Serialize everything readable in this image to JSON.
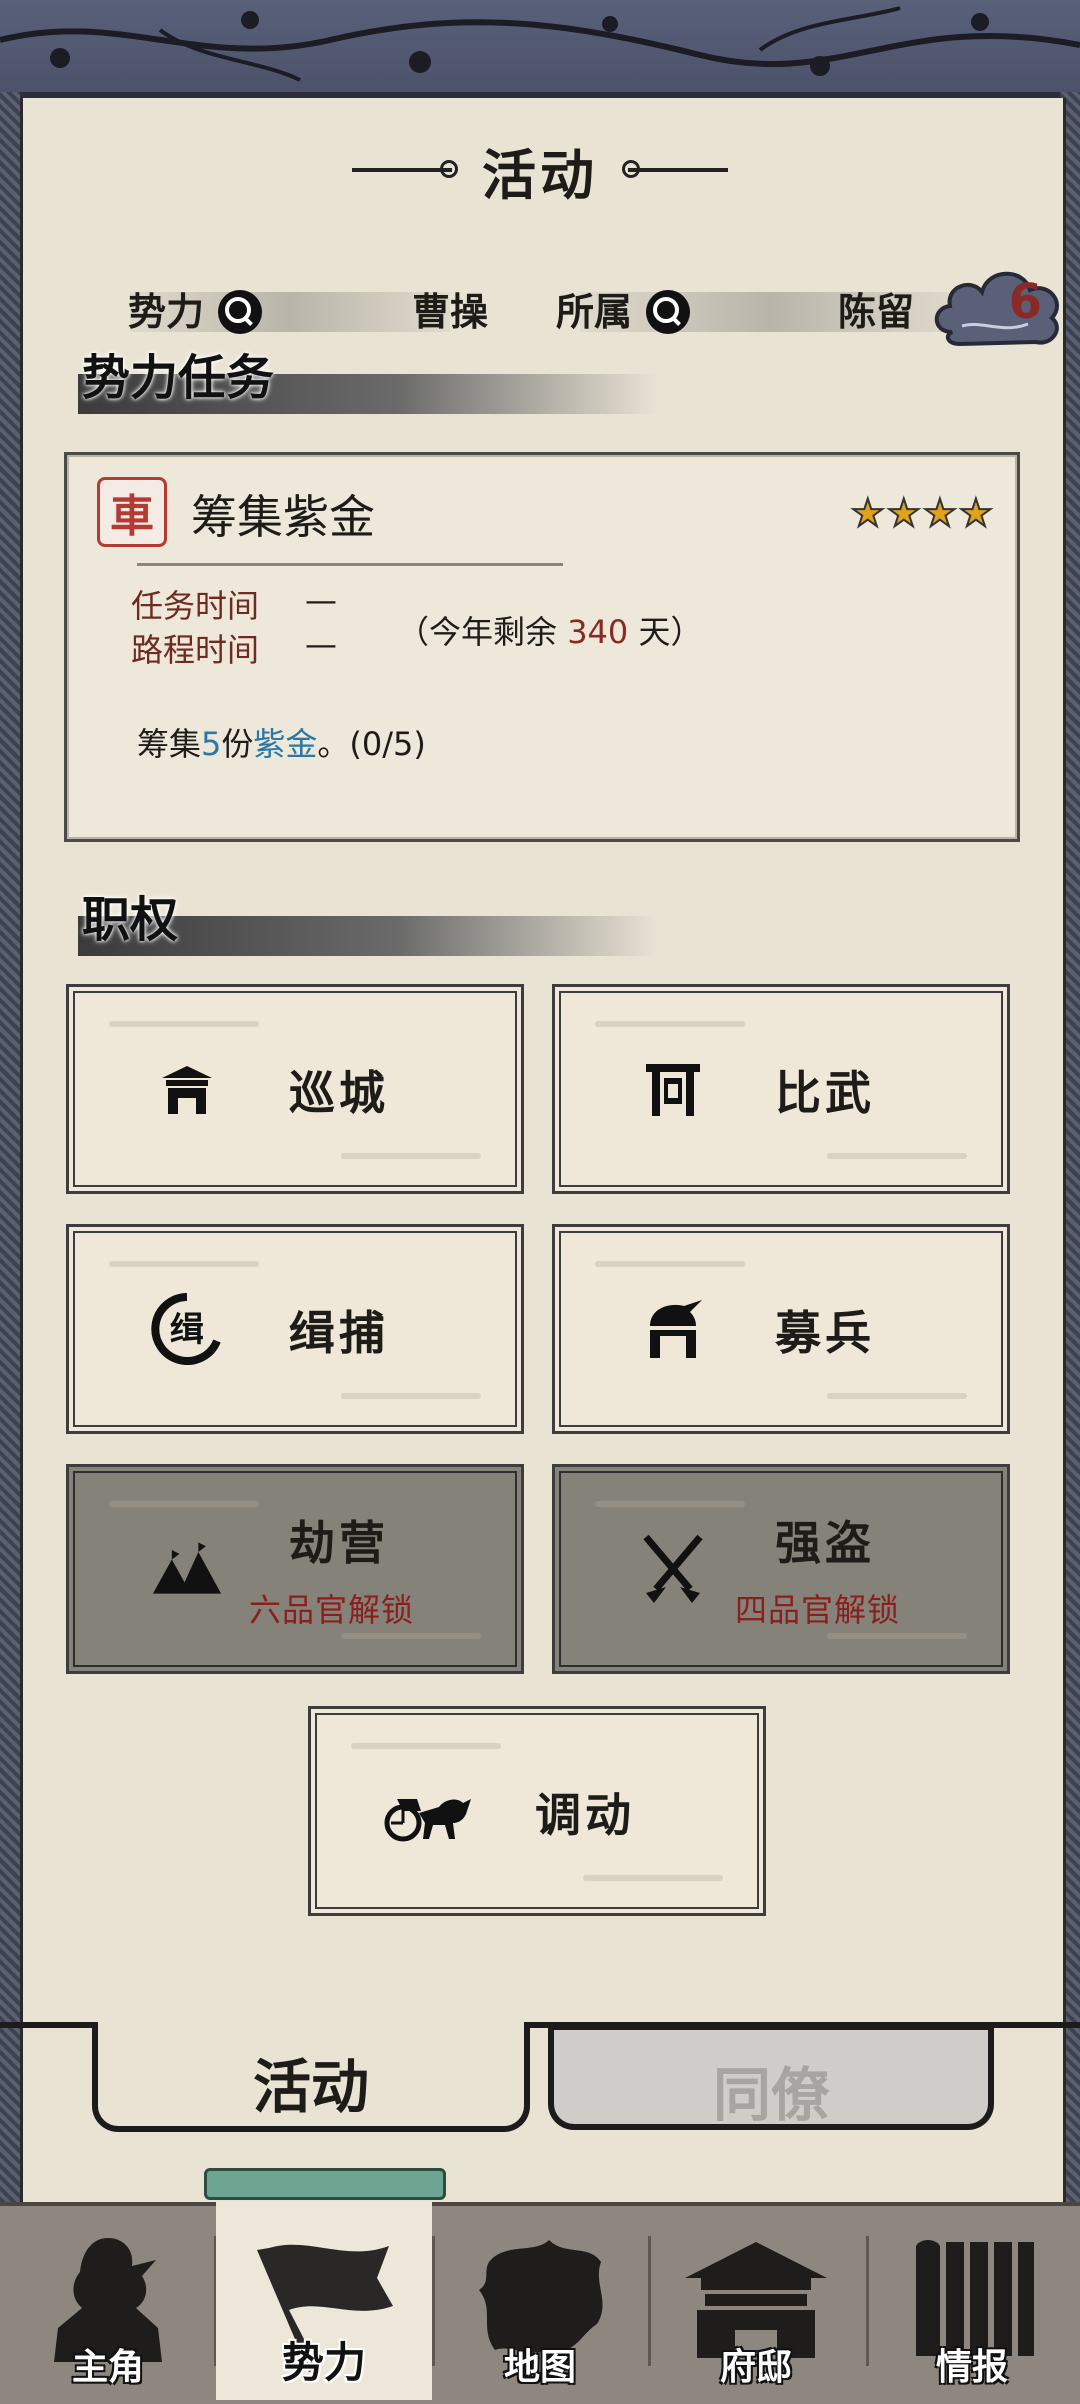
{
  "header": {
    "title": "活动"
  },
  "faction_info": {
    "faction_label": "势力",
    "faction_value": "曹操",
    "belong_label": "所属",
    "belong_value": "陈留",
    "badge_count": "6"
  },
  "faction_tasks": {
    "section_title": "势力任务",
    "task": {
      "seal_char": "車",
      "name": "筹集紫金",
      "stars": 4,
      "task_time_label": "任务时间",
      "task_time_value": "—",
      "route_time_label": "路程时间",
      "route_time_value": "—",
      "remaining_prefix": "（今年剩余",
      "remaining_days": "340",
      "remaining_suffix": "天）",
      "desc_prefix": "筹集",
      "desc_count": "5",
      "desc_mid": "份",
      "desc_item": "紫金",
      "desc_suffix": "。(0/5)"
    }
  },
  "powers": {
    "section_title": "职权",
    "buttons": [
      {
        "label": "巡城",
        "icon": "city-gate-icon",
        "locked": false,
        "lock_text": ""
      },
      {
        "label": "比武",
        "icon": "arena-gate-icon",
        "locked": false,
        "lock_text": ""
      },
      {
        "label": "缉捕",
        "icon": "arrest-seal-icon",
        "locked": false,
        "lock_text": ""
      },
      {
        "label": "募兵",
        "icon": "soldier-helmet-icon",
        "locked": false,
        "lock_text": ""
      },
      {
        "label": "劫营",
        "icon": "camp-tents-icon",
        "locked": true,
        "lock_text": "六品官解锁"
      },
      {
        "label": "强盗",
        "icon": "crossed-swords-icon",
        "locked": true,
        "lock_text": "四品官解锁"
      },
      {
        "label": "调动",
        "icon": "chariot-icon",
        "locked": false,
        "lock_text": ""
      }
    ]
  },
  "tabs": [
    {
      "label": "活动",
      "active": true
    },
    {
      "label": "同僚",
      "active": false
    }
  ],
  "nav": [
    {
      "label": "主角",
      "icon": "warrior-icon",
      "active": false
    },
    {
      "label": "势力",
      "icon": "flag-icon",
      "active": true
    },
    {
      "label": "地图",
      "icon": "map-icon",
      "active": false
    },
    {
      "label": "府邸",
      "icon": "mansion-icon",
      "active": false
    },
    {
      "label": "情报",
      "icon": "scroll-icon",
      "active": false
    }
  ],
  "colors": {
    "paper": "#e9e3d4",
    "ink": "#1e1c19",
    "seal_red": "#b33b33",
    "lock_red": "#8c1f1c",
    "highlight_blue": "#2b78a6",
    "star_gold": "#e0a21c"
  }
}
